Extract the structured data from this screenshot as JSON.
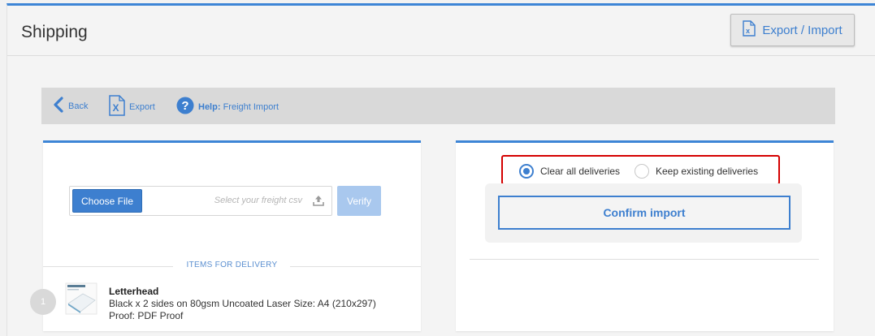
{
  "header": {
    "title": "Shipping",
    "export_import_label": "Export / Import"
  },
  "toolbar": {
    "back_label": "Back",
    "export_label": "Export",
    "help_prefix": "Help:",
    "help_label": "Freight Import"
  },
  "upload": {
    "choose_file_label": "Choose File",
    "placeholder": "Select your freight csv",
    "verify_label": "Verify"
  },
  "items_section": {
    "heading": "ITEMS FOR DELIVERY",
    "items": [
      {
        "index": "1",
        "name": "Letterhead",
        "description": "Black x 2 sides on 80gsm Uncoated Laser Size: A4 (210x297) Proof: PDF Proof"
      }
    ]
  },
  "import_options": {
    "clear_label": "Clear all deliveries",
    "keep_label": "Keep existing deliveries",
    "selected": "clear",
    "confirm_label": "Confirm import"
  },
  "colors": {
    "accent": "#3d7fcf",
    "highlight_border": "#d40000",
    "toolbar_bg": "#d9d9d9"
  }
}
